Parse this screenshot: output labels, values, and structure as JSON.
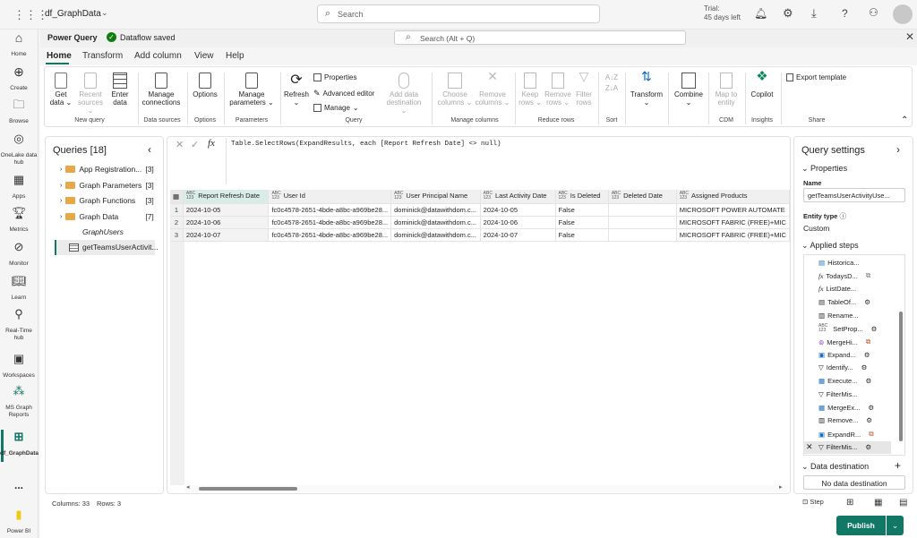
{
  "topbar": {
    "app_name": "df_GraphData",
    "search_placeholder": "Search",
    "trial_line1": "Trial:",
    "trial_line2": "45 days left"
  },
  "rail": [
    {
      "label": "Home"
    },
    {
      "label": "Create"
    },
    {
      "label": "Browse"
    },
    {
      "label": "OneLake data hub"
    },
    {
      "label": "Apps"
    },
    {
      "label": "Metrics"
    },
    {
      "label": "Monitor"
    },
    {
      "label": "Learn"
    },
    {
      "label": "Real-Time hub"
    },
    {
      "label": "Workspaces"
    },
    {
      "label": "MS Graph Reports"
    },
    {
      "label": "df_GraphData"
    },
    {
      "label": "..."
    },
    {
      "label": "Power BI"
    }
  ],
  "pq": {
    "title": "Power Query",
    "saved": "Dataflow saved",
    "search": "Search (Alt + Q)"
  },
  "tabs": [
    "Home",
    "Transform",
    "Add column",
    "View",
    "Help"
  ],
  "ribbon": {
    "get_data": "Get data",
    "recent_sources": "Recent sources",
    "enter_data": "Enter data",
    "new_query": "New query",
    "manage_connections": "Manage connections",
    "data_sources": "Data sources",
    "options": "Options",
    "options_group": "Options",
    "manage_parameters": "Manage parameters",
    "parameters_group": "Parameters",
    "refresh": "Refresh",
    "properties": "Properties",
    "advanced_editor": "Advanced editor",
    "manage": "Manage",
    "add_data_destination": "Add data destination",
    "query_group": "Query",
    "choose_columns": "Choose columns",
    "remove_columns": "Remove columns",
    "manage_columns_group": "Manage columns",
    "keep_rows": "Keep rows",
    "remove_rows": "Remove rows",
    "filter_rows": "Filter rows",
    "reduce_rows_group": "Reduce rows",
    "sort_group": "Sort",
    "transform": "Transform",
    "combine": "Combine",
    "map_to_entity": "Map to entity",
    "cdm_group": "CDM",
    "copilot": "Copilot",
    "insights_group": "Insights",
    "export_template": "Export template",
    "share_group": "Share"
  },
  "queries": {
    "header": "Queries [18]",
    "items": [
      {
        "label": "App Registration...",
        "count": "[3]"
      },
      {
        "label": "Graph Parameters",
        "count": "[3]"
      },
      {
        "label": "Graph Functions",
        "count": "[3]"
      },
      {
        "label": "Graph Data",
        "count": "[7]"
      },
      {
        "label": "GraphUsers",
        "count": ""
      },
      {
        "label": "getTeamsUserActivit...",
        "count": ""
      }
    ]
  },
  "formula": "Table.SelectRows(ExpandResults, each [Report Refresh Date] <> null)",
  "grid": {
    "columns": [
      "Report Refresh Date",
      "User Id",
      "User Principal Name",
      "Last Activity Date",
      "Is Deleted",
      "Deleted Date",
      "Assigned Products"
    ],
    "rows": [
      [
        "1",
        "2024-10-05",
        "fc0c4578-2651-4bde-a8bc-a969be28...",
        "dominick@datawithdom.c...",
        "2024-10-05",
        "False",
        "",
        "MICROSOFT POWER AUTOMATE"
      ],
      [
        "2",
        "2024-10-06",
        "fc0c4578-2651-4bde-a8bc-a969be28...",
        "dominick@datawithdom.c...",
        "2024-10-06",
        "False",
        "",
        "MICROSOFT FABRIC (FREE)+MIC"
      ],
      [
        "3",
        "2024-10-07",
        "fc0c4578-2651-4bde-a8bc-a969be28...",
        "dominick@datawithdom.c...",
        "2024-10-07",
        "False",
        "",
        "MICROSOFT FABRIC (FREE)+MIC"
      ]
    ]
  },
  "settings": {
    "title": "Query settings",
    "properties": "Properties",
    "name_label": "Name",
    "name_value": "getTeamsUserActivityUse...",
    "entity_type_label": "Entity type",
    "entity_type_value": "Custom",
    "applied_steps": "Applied steps",
    "data_destination": "Data destination",
    "no_destination": "No data destination",
    "steps": [
      "Historica...",
      "TodaysD...",
      "ListDate...",
      "TableOf...",
      "Rename...",
      "SetProp...",
      "MergeHi...",
      "Expand...",
      "Identify...",
      "Execute...",
      "FilterMis...",
      "MergeEx...",
      "Remove...",
      "ExpandR...",
      "FilterMis..."
    ]
  },
  "status": {
    "columns": "Columns: 33",
    "rows": "Rows: 3",
    "step": "Step"
  },
  "publish": "Publish"
}
